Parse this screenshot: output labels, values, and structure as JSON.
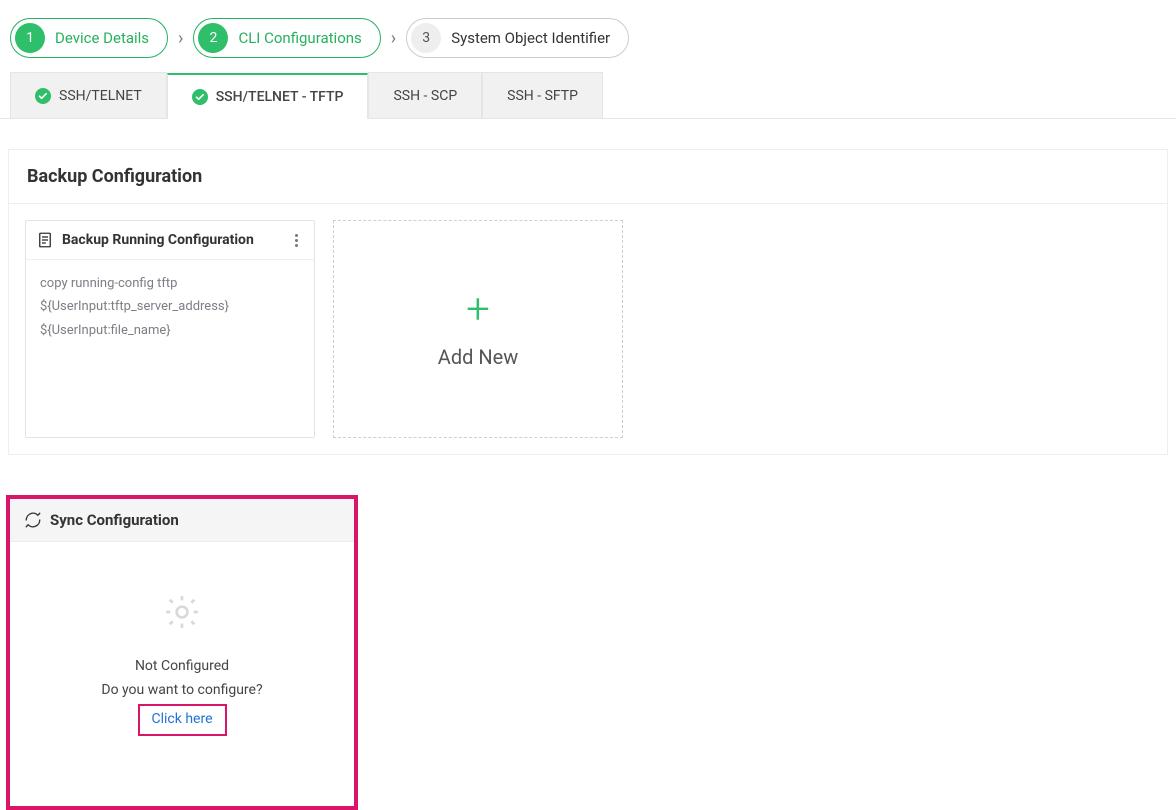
{
  "stepper": {
    "steps": [
      {
        "num": "1",
        "label": "Device Details"
      },
      {
        "num": "2",
        "label": "CLI Configurations"
      },
      {
        "num": "3",
        "label": "System Object Identifier"
      }
    ]
  },
  "tabs": [
    {
      "label": "SSH/TELNET",
      "check": true
    },
    {
      "label": "SSH/TELNET - TFTP",
      "check": true
    },
    {
      "label": "SSH - SCP",
      "check": false
    },
    {
      "label": "SSH - SFTP",
      "check": false
    }
  ],
  "backup": {
    "section_title": "Backup Configuration",
    "card_title": "Backup Running Configuration",
    "lines": [
      "copy running-config tftp",
      "${UserInput:tftp_server_address}",
      "${UserInput:file_name}"
    ],
    "add_label": "Add New"
  },
  "sync": {
    "title": "Sync Configuration",
    "not_configured": "Not Configured",
    "prompt": "Do you want to configure?",
    "link": "Click here"
  }
}
